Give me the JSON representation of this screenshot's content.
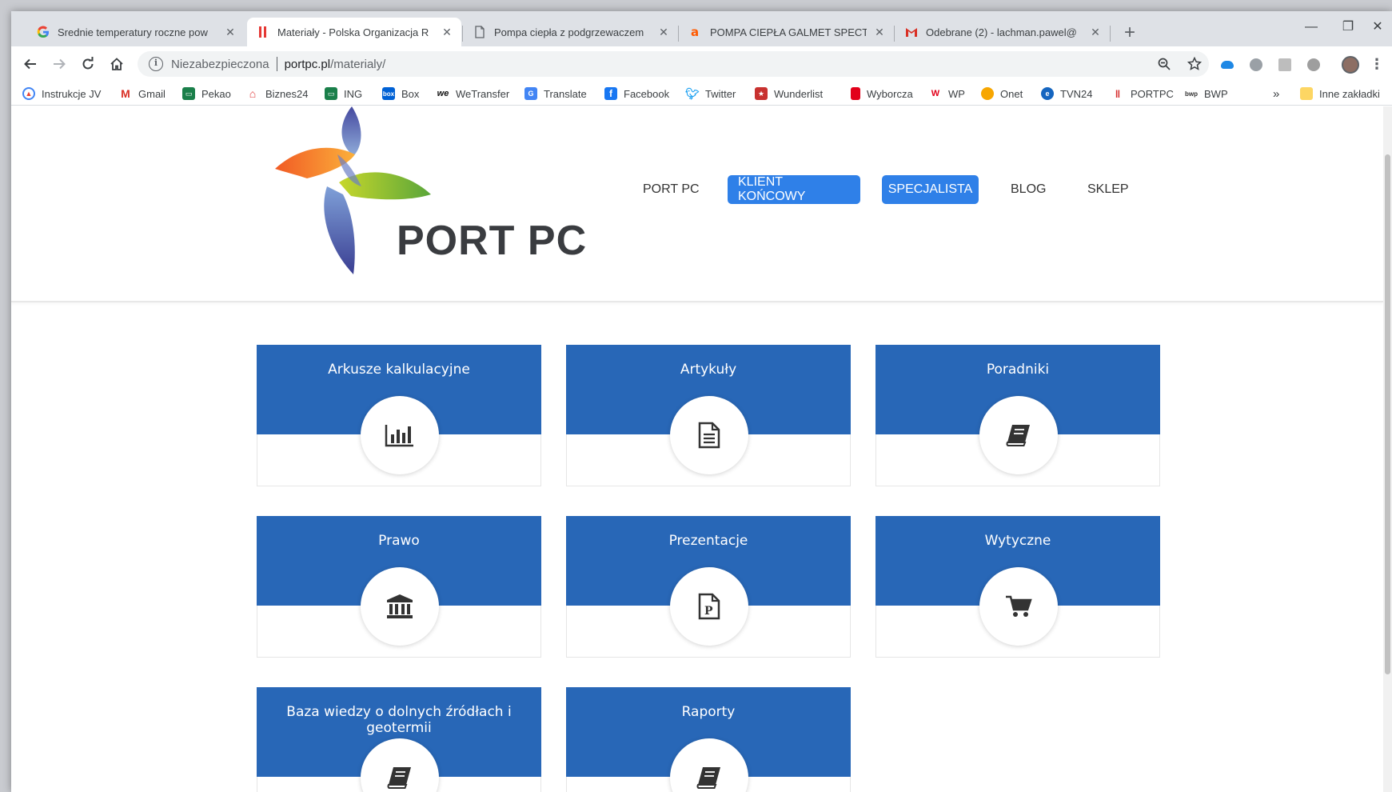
{
  "tabs": [
    {
      "title": "Srednie temperatury roczne pow",
      "icon": "google-icon"
    },
    {
      "title": "Materiały - Polska Organizacja R",
      "icon": "portpc-icon",
      "active": true
    },
    {
      "title": "Pompa ciepła z podgrzewaczem",
      "icon": "document-icon"
    },
    {
      "title": "POMPA CIEPŁA GALMET SPECTR",
      "icon": "allegro-icon"
    },
    {
      "title": "Odebrane (2) - lachman.pawel@",
      "icon": "gmail-icon"
    }
  ],
  "address": {
    "security_label": "Niezabezpieczona",
    "host": "portpc.pl",
    "path": "/materialy/"
  },
  "bookmarks": [
    {
      "label": "Instrukcje JV",
      "color": "#4285f4"
    },
    {
      "label": "Gmail",
      "color": "#d93025"
    },
    {
      "label": "Pekao",
      "color": "#1a7f4a"
    },
    {
      "label": "Biznes24",
      "color": "#e03a3a"
    },
    {
      "label": "ING",
      "color": "#1a7f4a"
    },
    {
      "label": "Box",
      "color": "#0061d5"
    },
    {
      "label": "WeTransfer",
      "color": "#111111"
    },
    {
      "label": "Translate",
      "color": "#4285f4"
    },
    {
      "label": "Facebook",
      "color": "#1877f2"
    },
    {
      "label": "Twitter",
      "color": "#1da1f2"
    },
    {
      "label": "Wunderlist",
      "color": "#c8312f"
    },
    {
      "label": "Wyborcza",
      "color": "#e2001a"
    },
    {
      "label": "WP",
      "color": "#e2001a"
    },
    {
      "label": "Onet",
      "color": "#f7a600"
    },
    {
      "label": "TVN24",
      "color": "#1565c0"
    },
    {
      "label": "PORTPC",
      "color": "#d62d2d"
    },
    {
      "label": "BWP",
      "color": "#333333"
    }
  ],
  "bookmarks_more": "»",
  "other_bookmarks": "Inne zakładki",
  "site": {
    "logo_text": "PORT PC",
    "nav": [
      "PORT PC",
      "KLIENT KOŃCOWY",
      "SPECJALISTA",
      "BLOG",
      "SKLEP"
    ],
    "accent": "#2f80e8",
    "card_color": "#2867b7"
  },
  "cards": [
    {
      "label": "Arkusze kalkulacyjne",
      "icon": "bar-chart-icon"
    },
    {
      "label": "Artykuły",
      "icon": "document-icon"
    },
    {
      "label": "Poradniki",
      "icon": "book-icon"
    },
    {
      "label": "Prawo",
      "icon": "bank-icon"
    },
    {
      "label": "Prezentacje",
      "icon": "presentation-file-icon"
    },
    {
      "label": "Wytyczne",
      "icon": "cart-icon"
    },
    {
      "label": "Baza wiedzy o dolnych źródłach i geotermii",
      "icon": "book-icon"
    },
    {
      "label": "Raporty",
      "icon": "book-icon"
    }
  ]
}
